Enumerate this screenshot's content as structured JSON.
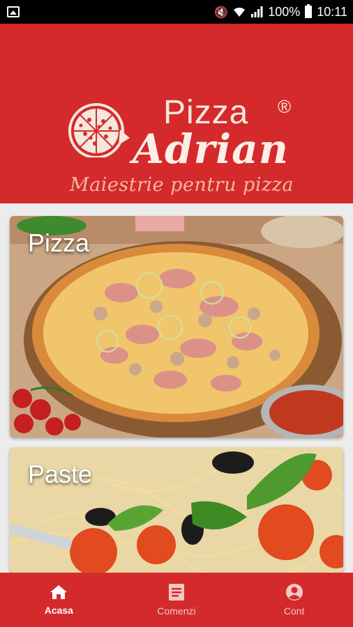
{
  "status_bar": {
    "battery": "100%",
    "time": "10:11",
    "icons": [
      "image-icon",
      "mute-icon",
      "wifi-icon",
      "signal-icon",
      "battery-icon"
    ]
  },
  "brand": {
    "logo_alt": "pizza-logo",
    "word_pizza": "Pizza",
    "registered": "®",
    "name": "Adrian",
    "tagline": "Maiestrie pentru pizza",
    "colors": {
      "primary_red": "#d42a2c",
      "cream": "#f6e7dc"
    }
  },
  "categories": [
    {
      "label": "Pizza",
      "image": "pizza-photo"
    },
    {
      "label": "Paste",
      "image": "pasta-photo"
    }
  ],
  "bottom_nav": {
    "active": "Acasa",
    "items": [
      {
        "label": "Acasa",
        "icon": "home-icon"
      },
      {
        "label": "Comenzi",
        "icon": "orders-icon"
      },
      {
        "label": "Cont",
        "icon": "account-icon"
      }
    ]
  }
}
